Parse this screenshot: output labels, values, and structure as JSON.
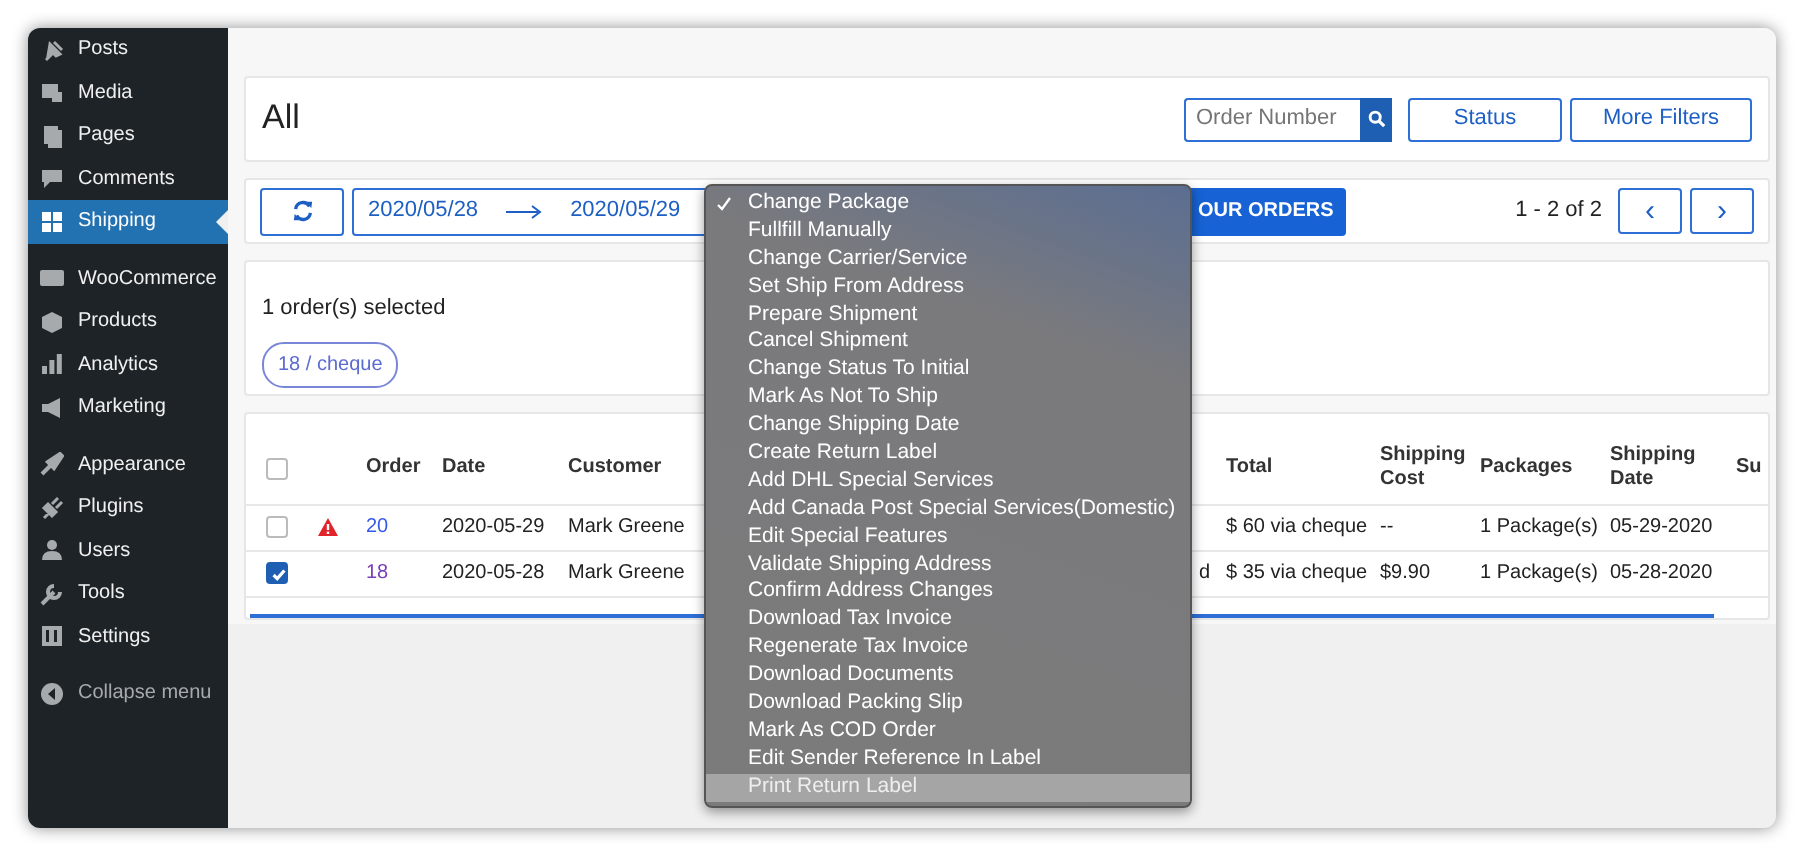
{
  "sidebar": {
    "groups": [
      [
        {
          "label": "Posts",
          "selected": false
        },
        {
          "label": "Media",
          "selected": false
        },
        {
          "label": "Pages",
          "selected": false
        },
        {
          "label": "Comments",
          "selected": false
        },
        {
          "label": "Shipping",
          "selected": true
        }
      ],
      [
        {
          "label": "WooCommerce",
          "selected": false
        },
        {
          "label": "Products",
          "selected": false
        },
        {
          "label": "Analytics",
          "selected": false
        },
        {
          "label": "Marketing",
          "selected": false
        }
      ],
      [
        {
          "label": "Appearance",
          "selected": false
        },
        {
          "label": "Plugins",
          "selected": false
        },
        {
          "label": "Users",
          "selected": false
        },
        {
          "label": "Tools",
          "selected": false
        },
        {
          "label": "Settings",
          "selected": false
        }
      ]
    ],
    "collapse": "Collapse menu"
  },
  "header": {
    "title": "All",
    "search": {
      "placeholder": "Order Number"
    },
    "buttons": [
      "Status",
      "More Filters"
    ]
  },
  "toolbar": {
    "date_from": "2020/05/28",
    "date_to": "2020/05/29",
    "action_button": "OUR ORDERS",
    "pagination": "1 - 2 of 2",
    "prev": "‹",
    "next": "›"
  },
  "selection": {
    "text": "1 order(s) selected",
    "tags": [
      "18 / cheque"
    ]
  },
  "table": {
    "all_checked": false,
    "columns": [
      "Order",
      "Date",
      "Customer",
      "",
      "Total",
      "Shipping Cost",
      "Packages",
      "Shipping Date",
      "Su"
    ],
    "rows": [
      {
        "checked": false,
        "warning": true,
        "visited": false,
        "cells": [
          "20",
          "2020-05-29",
          "Mark Greene",
          "",
          "$ 60 via cheque",
          "--",
          "1 Package(s)",
          "05-29-2020",
          ""
        ]
      },
      {
        "checked": true,
        "warning": false,
        "visited": true,
        "cells": [
          "18",
          "2020-05-28",
          "Mark Greene",
          "d",
          "$ 35 via cheque",
          "$9.90",
          "1 Package(s)",
          "05-28-2020",
          ""
        ]
      }
    ]
  },
  "menu": {
    "items": [
      {
        "label": "Change Package",
        "checked": true,
        "highlighted": false
      },
      {
        "label": "Fullfill Manually",
        "checked": false,
        "highlighted": false
      },
      {
        "label": "Change Carrier/Service",
        "checked": false,
        "highlighted": false
      },
      {
        "label": "Set Ship From Address",
        "checked": false,
        "highlighted": false
      },
      {
        "label": "Prepare Shipment",
        "checked": false,
        "highlighted": false
      },
      {
        "label": "Cancel Shipment",
        "checked": false,
        "highlighted": false
      },
      {
        "label": "Change Status To Initial",
        "checked": false,
        "highlighted": false
      },
      {
        "label": "Mark As Not To Ship",
        "checked": false,
        "highlighted": false
      },
      {
        "label": "Change Shipping Date",
        "checked": false,
        "highlighted": false
      },
      {
        "label": "Create Return Label",
        "checked": false,
        "highlighted": false
      },
      {
        "label": "Add DHL Special Services",
        "checked": false,
        "highlighted": false
      },
      {
        "label": "Add Canada Post Special Services(Domestic)",
        "checked": false,
        "highlighted": false
      },
      {
        "label": "Edit Special Features",
        "checked": false,
        "highlighted": false
      },
      {
        "label": "Validate Shipping Address",
        "checked": false,
        "highlighted": false
      },
      {
        "label": "Confirm Address Changes",
        "checked": false,
        "highlighted": false
      },
      {
        "label": "Download Tax Invoice",
        "checked": false,
        "highlighted": false
      },
      {
        "label": "Regenerate Tax Invoice",
        "checked": false,
        "highlighted": false
      },
      {
        "label": "Download Documents",
        "checked": false,
        "highlighted": false
      },
      {
        "label": "Download Packing Slip",
        "checked": false,
        "highlighted": false
      },
      {
        "label": "Mark As COD Order",
        "checked": false,
        "highlighted": false
      },
      {
        "label": "Edit Sender Reference In Label",
        "checked": false,
        "highlighted": false
      },
      {
        "label": "Print Return Label",
        "checked": false,
        "highlighted": true
      }
    ]
  }
}
